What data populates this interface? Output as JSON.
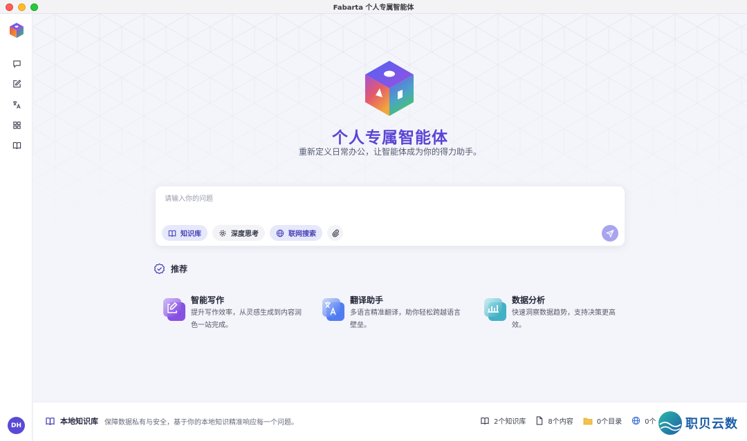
{
  "window": {
    "title": "Fabarta 个人专属智能体"
  },
  "sidebar": {
    "items": [
      {
        "name": "chat",
        "icon": "chat-icon"
      },
      {
        "name": "write",
        "icon": "edit-icon"
      },
      {
        "name": "translate",
        "icon": "translate-icon"
      },
      {
        "name": "apps",
        "icon": "grid-icon"
      },
      {
        "name": "knowledge",
        "icon": "book-icon"
      }
    ],
    "avatar": "DH"
  },
  "hero": {
    "title": "个人专属智能体",
    "subtitle": "重新定义日常办公，让智能体成为你的得力助手。"
  },
  "input": {
    "placeholder": "请输入你的问题",
    "value": "",
    "chips": [
      {
        "label": "知识库",
        "icon": "book-icon",
        "active": true
      },
      {
        "label": "深度思考",
        "icon": "gear-icon",
        "active": false
      },
      {
        "label": "联网搜索",
        "icon": "globe-icon",
        "active": true
      }
    ],
    "attach_icon": "paperclip-icon",
    "send_icon": "send-icon"
  },
  "recommend": {
    "label": "推荐",
    "cards": [
      {
        "title": "智能写作",
        "desc": "提升写作效率，从灵感生成到内容润色一站完成。",
        "icon": "edit-icon",
        "color": "#8a55e6"
      },
      {
        "title": "翻译助手",
        "desc": "多语言精准翻译，助你轻松跨越语言壁垒。",
        "icon": "translate-icon",
        "color": "#4f7bf0"
      },
      {
        "title": "数据分析",
        "desc": "快速洞察数据趋势，支持决策更高效。",
        "icon": "chart-icon",
        "color": "#3fb6c9"
      }
    ]
  },
  "footer": {
    "title": "本地知识库",
    "desc": "保障数据私有与安全，基于你的本地知识精准响应每一个问题。",
    "stats": [
      {
        "label": "2个知识库",
        "icon": "book-icon"
      },
      {
        "label": "8个内容",
        "icon": "file-icon"
      },
      {
        "label": "0个目录",
        "icon": "folder-icon"
      },
      {
        "label": "0个",
        "icon": "globe-icon"
      }
    ]
  },
  "watermark": {
    "text": "职贝云数"
  },
  "colors": {
    "accent": "#5b44d6",
    "send": "#a9a4ee",
    "chip_active": "#e6e8fb"
  }
}
